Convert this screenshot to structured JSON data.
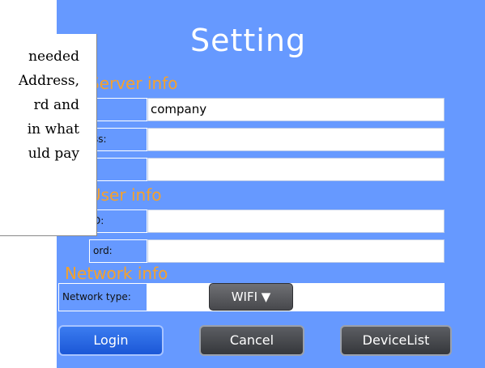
{
  "title": "Setting",
  "sections": {
    "server": "Server info",
    "user": "User info",
    "network": "Network info"
  },
  "server": {
    "name_label": "",
    "name_value": "company",
    "address_label": "ss:",
    "address_value": "",
    "port_label": "",
    "port_value": ""
  },
  "user": {
    "id_label": "D:",
    "id_value": "",
    "password_label": "ord:",
    "password_value": ""
  },
  "network": {
    "type_label": "Network type:",
    "type_value": "WIFI ▼"
  },
  "buttons": {
    "login": "Login",
    "cancel": "Cancel",
    "devicelist": "DeviceList"
  },
  "overlay_text": {
    "line1": "needed",
    "line2": "Address,",
    "line3": "rd   and",
    "line4": "in what",
    "line5": "uld pay"
  },
  "colors": {
    "background": "#6699ff",
    "section_header": "#f7a12a",
    "login_button": "#1b57d6",
    "dark_button": "#35373b"
  }
}
